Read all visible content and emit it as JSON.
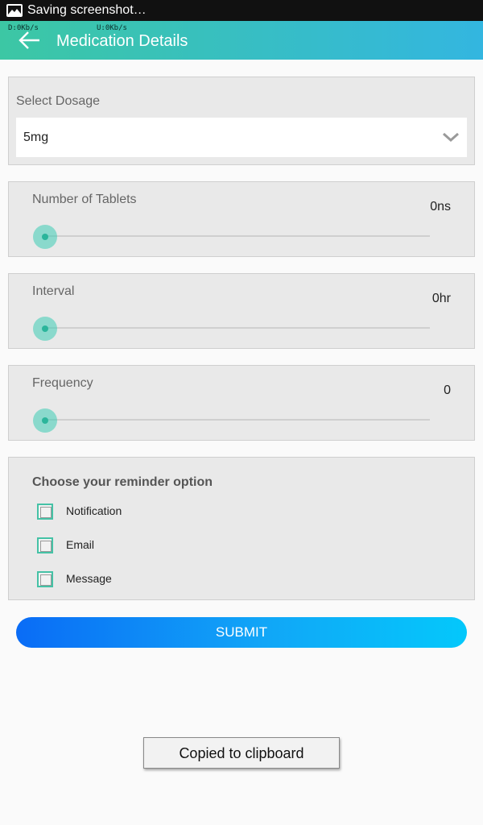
{
  "status_bar": {
    "text": "Saving screenshot…",
    "icon": "image-icon"
  },
  "app_bar": {
    "net_down": "D:0Kb/s",
    "net_up": "U:0Kb/s",
    "title": "Medication Details",
    "back_icon": "arrow-back-icon"
  },
  "dosage": {
    "label": "Select Dosage",
    "selected": "5mg",
    "dropdown_icon": "chevron-down-icon"
  },
  "sliders": [
    {
      "label": "Number of Tablets",
      "value": "0ns",
      "level": 0
    },
    {
      "label": "Interval",
      "value": "0hr",
      "level": 0
    },
    {
      "label": "Frequency",
      "value": "0",
      "level": 0
    }
  ],
  "reminder": {
    "title": "Choose your reminder option",
    "options": [
      {
        "label": "Notification",
        "checked": false
      },
      {
        "label": "Email",
        "checked": false
      },
      {
        "label": "Message",
        "checked": false
      }
    ]
  },
  "submit_label": "SUBMIT",
  "toast": "Copied to clipboard",
  "colors": {
    "app_bar_start": "#3cc7a4",
    "app_bar_end": "#33b6e0",
    "accent": "#45c2a6",
    "submit_start": "#0a6cf6",
    "submit_end": "#04c8fb"
  }
}
